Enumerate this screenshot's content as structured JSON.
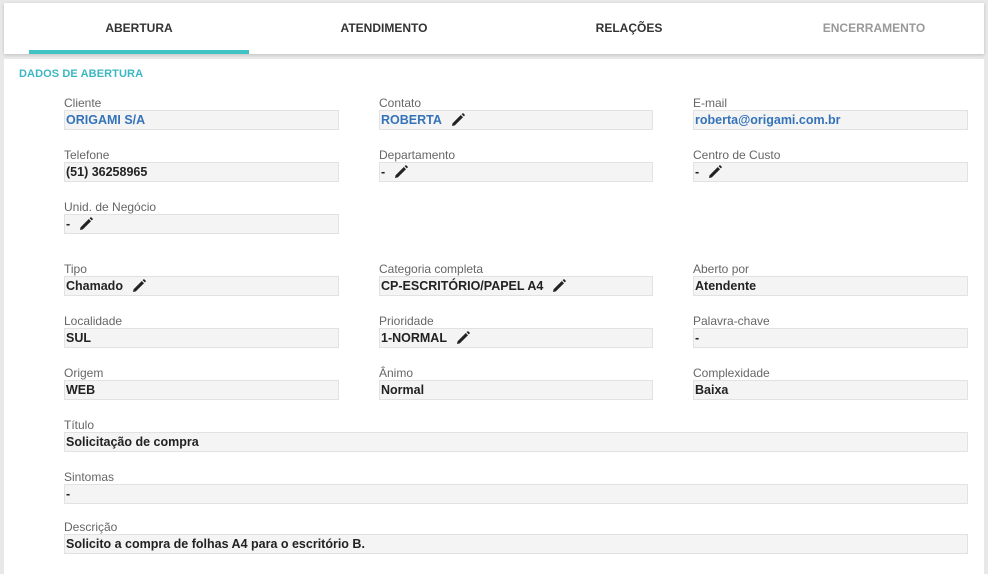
{
  "tabs": [
    {
      "label": "ABERTURA",
      "active": true
    },
    {
      "label": "ATENDIMENTO"
    },
    {
      "label": "RELAÇÕES"
    },
    {
      "label": "ENCERRAMENTO",
      "disabled": true
    }
  ],
  "section_title": "DADOS DE ABERTURA",
  "fields": {
    "cliente": {
      "label": "Cliente",
      "value": "ORIGAMI S/A"
    },
    "contato": {
      "label": "Contato",
      "value": "ROBERTA"
    },
    "email": {
      "label": "E-mail",
      "value": "roberta@origami.com.br"
    },
    "telefone": {
      "label": "Telefone",
      "value": "(51) 36258965"
    },
    "departamento": {
      "label": "Departamento",
      "value": "-"
    },
    "centro_custo": {
      "label": "Centro de Custo",
      "value": "-"
    },
    "unid_negocio": {
      "label": "Unid. de Negócio",
      "value": "-"
    },
    "tipo": {
      "label": "Tipo",
      "value": "Chamado"
    },
    "categoria": {
      "label": "Categoria completa",
      "value": "CP-ESCRITÓRIO/PAPEL A4"
    },
    "aberto_por": {
      "label": "Aberto por",
      "value": "Atendente"
    },
    "localidade": {
      "label": "Localidade",
      "value": "SUL"
    },
    "prioridade": {
      "label": "Prioridade",
      "value": "1-NORMAL"
    },
    "palavra_chave": {
      "label": "Palavra-chave",
      "value": "-"
    },
    "origem": {
      "label": "Origem",
      "value": "WEB"
    },
    "animo": {
      "label": "Ânimo",
      "value": "Normal"
    },
    "complexidade": {
      "label": "Complexidade",
      "value": "Baixa"
    },
    "titulo": {
      "label": "Título",
      "value": "Solicitação de compra"
    },
    "sintomas": {
      "label": "Sintomas",
      "value": "-"
    },
    "descricao": {
      "label": "Descrição",
      "value": "Solicito a compra de folhas A4 para o escritório B."
    }
  },
  "icons": {
    "edit": "pencil-icon"
  },
  "colors": {
    "accent": "#3fc3c4",
    "link": "#3573b9",
    "section_title": "#3cb7c2"
  }
}
